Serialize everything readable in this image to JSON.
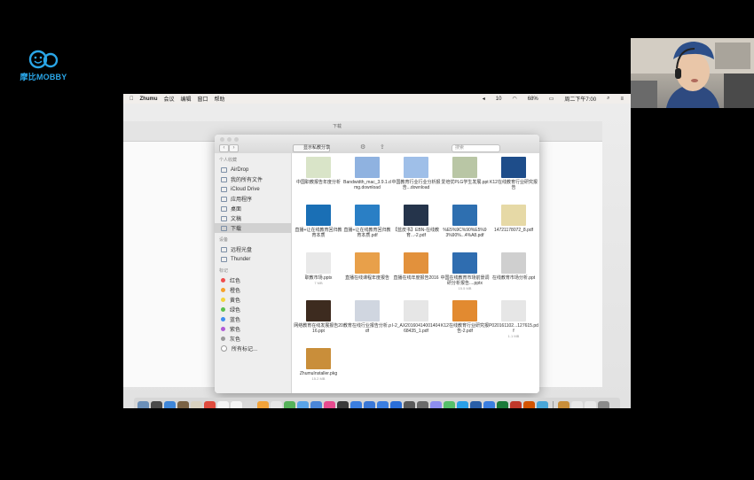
{
  "logo": {
    "text": "摩比MOBBY",
    "color": "#2aa6e8"
  },
  "menubar": {
    "apple": "",
    "app": "Zhumu",
    "items": [
      "会议",
      "编辑",
      "窗口",
      "帮助"
    ],
    "status": {
      "volume": "10",
      "battery": "68%",
      "clock": "周二下午7:00"
    }
  },
  "finder": {
    "title": "显示私教分享",
    "bg_title": "下载",
    "search_placeholder": "搜索",
    "sidebar": {
      "favorites_header": "个人收藏",
      "favorites": [
        "AirDrop",
        "我的所有文件",
        "iCloud Drive",
        "应用程序",
        "桌面",
        "文稿",
        "下载"
      ],
      "selected": "下载",
      "devices_header": "设备",
      "devices": [
        "远程光盘",
        "Thunder"
      ],
      "tags_header": "标记",
      "tags": [
        {
          "label": "红色",
          "color": "#ef4d4d"
        },
        {
          "label": "橙色",
          "color": "#f5a12b"
        },
        {
          "label": "黄色",
          "color": "#f2d43b"
        },
        {
          "label": "绿色",
          "color": "#5ac04d"
        },
        {
          "label": "蓝色",
          "color": "#3f8ef0"
        },
        {
          "label": "紫色",
          "color": "#b05ad6"
        },
        {
          "label": "灰色",
          "color": "#9a9a9a"
        },
        {
          "label": "所有标记...",
          "color": "#ffffff"
        }
      ]
    },
    "files": [
      {
        "name": "中国职教报告年度分析",
        "size": "",
        "thumb": "#d9e4c8"
      },
      {
        "name": "Bandwidth_mac_3.9.1.dmg.download",
        "size": "",
        "thumb": "#8fb2e0"
      },
      {
        "name": "中国教育行业行业分析报告...download",
        "size": "",
        "thumb": "#9fbfe8"
      },
      {
        "name": "爱培优PLG学生发展.ppt",
        "size": "",
        "thumb": "#b9c6a5"
      },
      {
        "name": "K12在线教育行业研究报告",
        "size": "",
        "thumb": "#1e4d8a"
      },
      {
        "name": "直播+让在线教育回归教育本质",
        "size": "",
        "thumb": "#1a6fb5"
      },
      {
        "name": "直播+让在线教育回归教育本质.pdf",
        "size": "",
        "thumb": "#2a7fc5"
      },
      {
        "name": "【蓝皮书】EBN-在线教育...-2.pdf",
        "size": "",
        "thumb": "#25344b"
      },
      {
        "name": "%E5%9C%90%E5%93%90%...4%A8.pdf",
        "size": "",
        "thumb": "#2e6fb0"
      },
      {
        "name": "14721178072_8.pdf",
        "size": "",
        "thumb": "#e6d9a6"
      },
      {
        "name": "职教市场.pptx",
        "size": "7 MB",
        "thumb": "#e9e9e9"
      },
      {
        "name": "直播在线课程年度报告",
        "size": "",
        "thumb": "#e8a04a"
      },
      {
        "name": "直播在线年度报告2016",
        "size": "",
        "thumb": "#e2913c"
      },
      {
        "name": "中国在线教育市场前景调研分析报告....pptx",
        "size": "15.5 MB",
        "thumb": "#2f6db0"
      },
      {
        "name": "在线教育市场分析.ppt",
        "size": "",
        "thumb": "#cfcfcf"
      },
      {
        "name": "网络教育在线发展报告2016.ppt",
        "size": "",
        "thumb": "#3d2b1f"
      },
      {
        "name": "教育在线行业报告分析.pdf",
        "size": "",
        "thumb": "#d0d6e0"
      },
      {
        "name": "I-2_AX2016041400140468435_1.pdf",
        "size": "",
        "thumb": "#e6e6e6"
      },
      {
        "name": "K12在线教育行业研究报告-2.pdf",
        "size": "",
        "thumb": "#e28a30"
      },
      {
        "name": "P020161102...127615.pdf",
        "size": "1.1 MB",
        "thumb": "#e6e6e6"
      },
      {
        "name": "ZhumuInstaller.pkg",
        "size": "15.2 MB",
        "thumb": "#c98e3a"
      }
    ]
  },
  "dock_colors": [
    "#6b8fb8",
    "#4a4a4a",
    "#3e86d9",
    "#7a6245",
    "#d9d2c0",
    "#e04b3d",
    "#f4f4f4",
    "#f4f4f4",
    "#d8d8d8",
    "#f2a33a",
    "#e6e6e6",
    "#56b35a",
    "#5aa4e8",
    "#4b86d8",
    "#e84b8f",
    "#3a3a3a",
    "#3b7ee0",
    "#3a78d8",
    "#3b7ee0",
    "#2a6ed8",
    "#5a5a5a",
    "#6a6a6a",
    "#8e8ef0",
    "#56c06a",
    "#2aa0e8",
    "#2a5fa8",
    "#3b7ee0",
    "#1b7a3a",
    "#c0392b",
    "#d35400",
    "#49a6d8",
    "#c98e3a",
    "#e8e8e8",
    "#e8e8e8",
    "#8a8a8a"
  ]
}
